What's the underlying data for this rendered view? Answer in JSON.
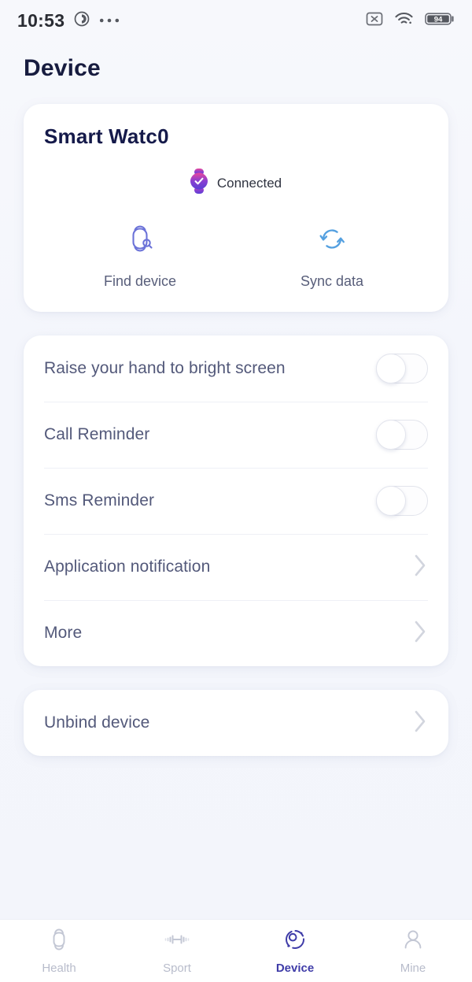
{
  "status_bar": {
    "time": "10:53",
    "record_icon": "screen-record-icon",
    "more_icon": "more-dots-icon",
    "nosim_icon": "no-sim-icon",
    "wifi_icon": "wifi-icon",
    "battery_level": "94"
  },
  "header": {
    "title": "Device"
  },
  "device_card": {
    "name": "Smart Watc0",
    "status_text": "Connected",
    "status_icon": "connected-watch-check-icon",
    "actions": [
      {
        "label": "Find device",
        "icon": "find-device-watch-search-icon"
      },
      {
        "label": "Sync data",
        "icon": "sync-refresh-icon"
      }
    ]
  },
  "settings": [
    {
      "label": "Raise your hand to bright screen",
      "control": "toggle",
      "value": "off"
    },
    {
      "label": "Call Reminder",
      "control": "toggle",
      "value": "off"
    },
    {
      "label": "Sms Reminder",
      "control": "toggle",
      "value": "off"
    },
    {
      "label": "Application notification",
      "control": "chevron"
    },
    {
      "label": "More",
      "control": "chevron"
    }
  ],
  "unbind": {
    "label": "Unbind device",
    "control": "chevron"
  },
  "tabbar": {
    "items": [
      {
        "label": "Health",
        "icon": "watch-icon",
        "active": false
      },
      {
        "label": "Sport",
        "icon": "dumbbell-icon",
        "active": false
      },
      {
        "label": "Device",
        "icon": "device-circle-icon",
        "active": true
      },
      {
        "label": "Mine",
        "icon": "person-icon",
        "active": false
      }
    ]
  },
  "colors": {
    "accent": "#3f3ca8",
    "title": "#171c3f",
    "label": "#53597a",
    "background": "#f4f6fb",
    "card": "#ffffff",
    "find_icon": "#6b72d8",
    "sync_icon": "#54a0e0",
    "connected_top": "#e0479e",
    "connected_bottom": "#5b3fd4"
  }
}
